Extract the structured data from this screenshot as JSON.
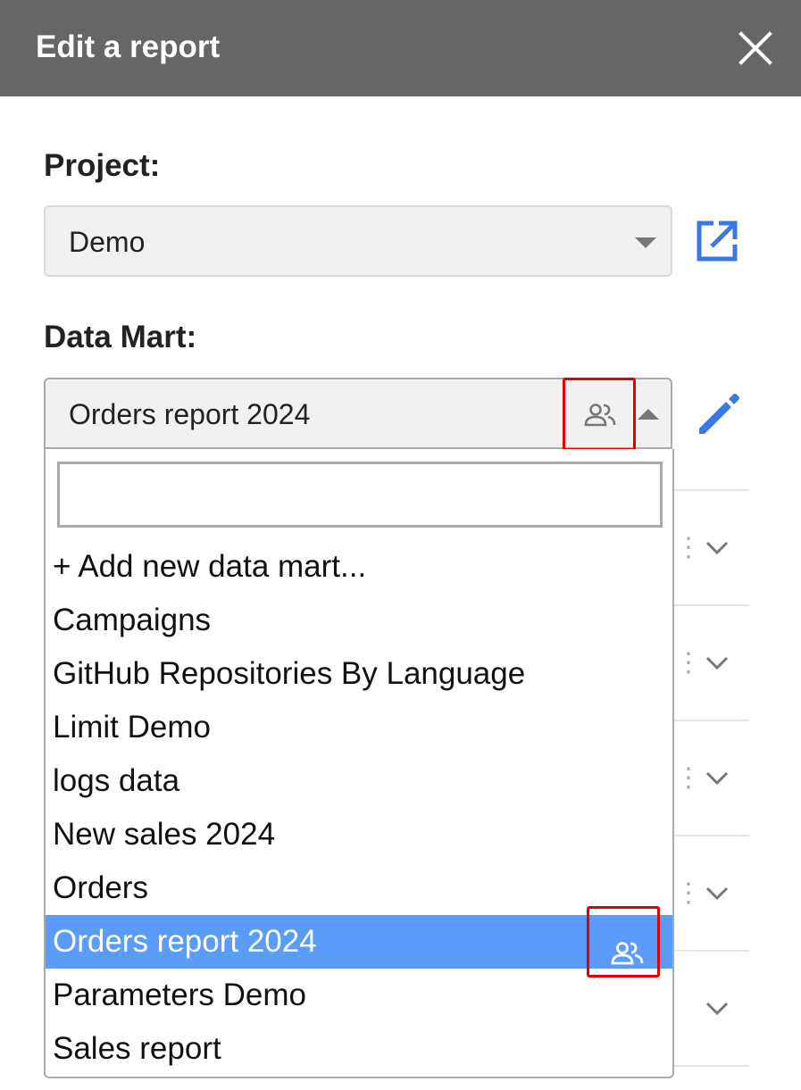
{
  "header": {
    "title": "Edit a report",
    "close_icon": "close-icon"
  },
  "project": {
    "label": "Project:",
    "value": "Demo",
    "open_icon": "open-in-new-icon"
  },
  "data_mart": {
    "label": "Data Mart:",
    "value": "Orders report 2024",
    "shared_icon": "people-icon",
    "edit_icon": "pencil-icon"
  },
  "dropdown": {
    "search_value": "",
    "options": [
      {
        "label": "+ Add new data mart...",
        "selected": false,
        "shared": false
      },
      {
        "label": "Campaigns",
        "selected": false,
        "shared": false
      },
      {
        "label": "GitHub Repositories By Language",
        "selected": false,
        "shared": false
      },
      {
        "label": "Limit Demo",
        "selected": false,
        "shared": false
      },
      {
        "label": "logs data",
        "selected": false,
        "shared": false
      },
      {
        "label": "New sales 2024",
        "selected": false,
        "shared": false
      },
      {
        "label": "Orders",
        "selected": false,
        "shared": false
      },
      {
        "label": "Orders report 2024",
        "selected": true,
        "shared": true
      },
      {
        "label": "Parameters Demo",
        "selected": false,
        "shared": false
      },
      {
        "label": "Sales report",
        "selected": false,
        "shared": false
      }
    ]
  },
  "colors": {
    "header_bg": "#666666",
    "accent_blue": "#3b78e7",
    "selected_bg": "#5b9cfa",
    "highlight_red": "#e30000"
  }
}
